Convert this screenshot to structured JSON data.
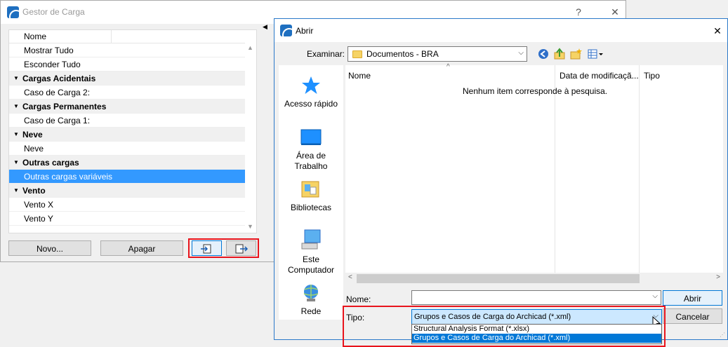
{
  "gestor": {
    "title": "Gestor de Carga",
    "help_label": "?",
    "close_label": "✕",
    "column_header": "Nome",
    "rows": [
      {
        "label": "Mostrar Tudo",
        "type": "item"
      },
      {
        "label": "Esconder Tudo",
        "type": "item"
      },
      {
        "label": "Cargas Acidentais",
        "type": "group"
      },
      {
        "label": "Caso de Carga 2:",
        "type": "item"
      },
      {
        "label": "Cargas Permanentes",
        "type": "group"
      },
      {
        "label": "Caso de Carga 1:",
        "type": "item"
      },
      {
        "label": "Neve",
        "type": "group"
      },
      {
        "label": "Neve",
        "type": "item"
      },
      {
        "label": "Outras cargas",
        "type": "group"
      },
      {
        "label": "Outras cargas variáveis",
        "type": "item",
        "selected": true
      },
      {
        "label": "Vento",
        "type": "group"
      },
      {
        "label": "Vento X",
        "type": "item"
      },
      {
        "label": "Vento Y",
        "type": "item"
      }
    ],
    "buttons": {
      "new_label": "Novo...",
      "delete_label": "Apagar",
      "import_icon": "import-icon",
      "export_icon": "export-icon"
    }
  },
  "abrir": {
    "title": "Abrir",
    "close_label": "✕",
    "look_in_label": "Examinar:",
    "look_in_value": "Documentos - BRA",
    "toolbar_icons": [
      "back-icon",
      "up-folder-icon",
      "new-folder-icon",
      "view-menu-icon"
    ],
    "places": [
      {
        "label": "Acesso rápido",
        "icon": "star-icon"
      },
      {
        "label": "Área de Trabalho",
        "icon": "desktop-icon"
      },
      {
        "label": "Bibliotecas",
        "icon": "libraries-icon"
      },
      {
        "label": "Este Computador",
        "icon": "computer-icon"
      },
      {
        "label": "Rede",
        "icon": "network-icon"
      }
    ],
    "columns": {
      "name": "Nome",
      "date": "Data de modificaçã...",
      "type": "Tipo"
    },
    "empty_message": "Nenhum item corresponde à pesquisa.",
    "filename_label": "Nome:",
    "filename_value": "",
    "type_label": "Tipo:",
    "type_value": "Grupos e Casos de Carga do Archicad (*.xml)",
    "type_options": [
      "Structural Analysis Format (*.xlsx)",
      "Grupos e Casos de Carga do Archicad (*.xml)"
    ],
    "selected_type_index": 1,
    "open_label": "Abrir",
    "cancel_label": "Cancelar"
  },
  "colors": {
    "selection": "#3399ff",
    "dropdown_selection": "#0078d7",
    "highlight_box": "#e8141c",
    "dialog_border": "#2b79c9"
  }
}
